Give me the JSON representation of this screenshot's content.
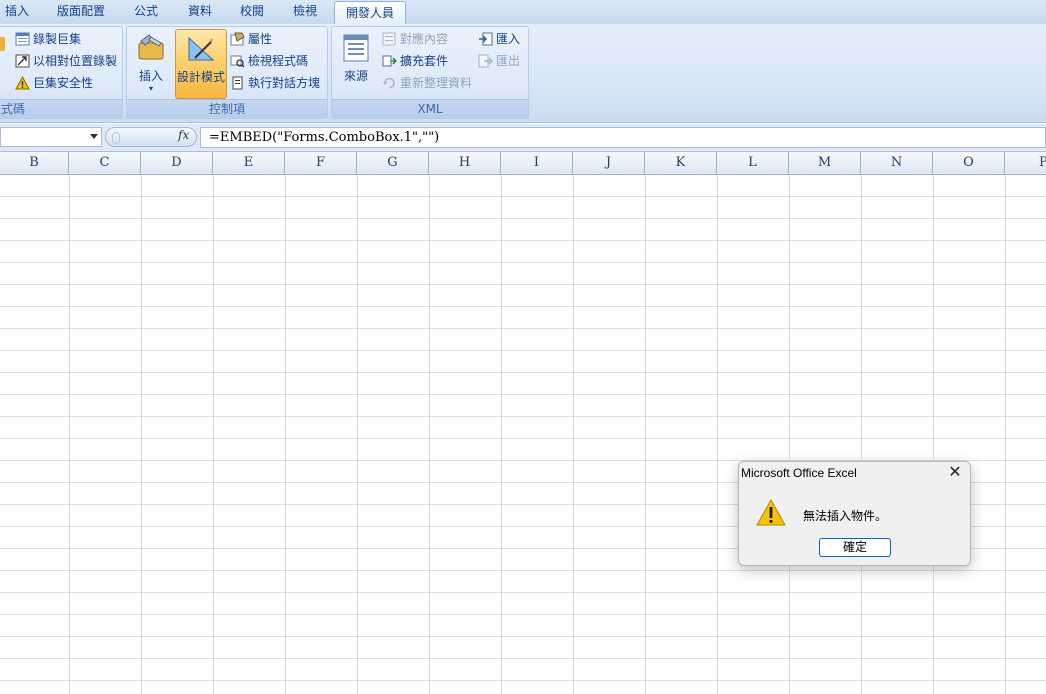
{
  "tabs": [
    "插入",
    "版面配置",
    "公式",
    "資料",
    "校閱",
    "檢視",
    "開發人員"
  ],
  "ribbon": {
    "code_group": {
      "label": "程式碼",
      "record_macro": "錄製巨集",
      "relative_ref": "以相對位置錄製",
      "macro_security": "巨集安全性"
    },
    "controls_group": {
      "label": "控制項",
      "insert": "插入",
      "design_mode": "設計模式",
      "properties": "屬性",
      "view_code": "檢視程式碼",
      "run_dialog": "執行對話方塊"
    },
    "xml_group": {
      "label": "XML",
      "source": "來源",
      "map_properties": "對應內容",
      "expansion_packs": "擴充套件",
      "refresh_data": "重新整理資料",
      "import": "匯入",
      "export": "匯出"
    }
  },
  "formula_bar": {
    "fx": "fx",
    "formula": "=EMBED(\"Forms.ComboBox.1\",\"\")"
  },
  "columns": [
    "B",
    "C",
    "D",
    "E",
    "F",
    "G",
    "H",
    "I",
    "J",
    "K",
    "L",
    "M",
    "N",
    "O",
    "P"
  ],
  "dialog": {
    "title": "Microsoft Office Excel",
    "close": "✕",
    "message": "無法插入物件。",
    "ok": "確定"
  }
}
